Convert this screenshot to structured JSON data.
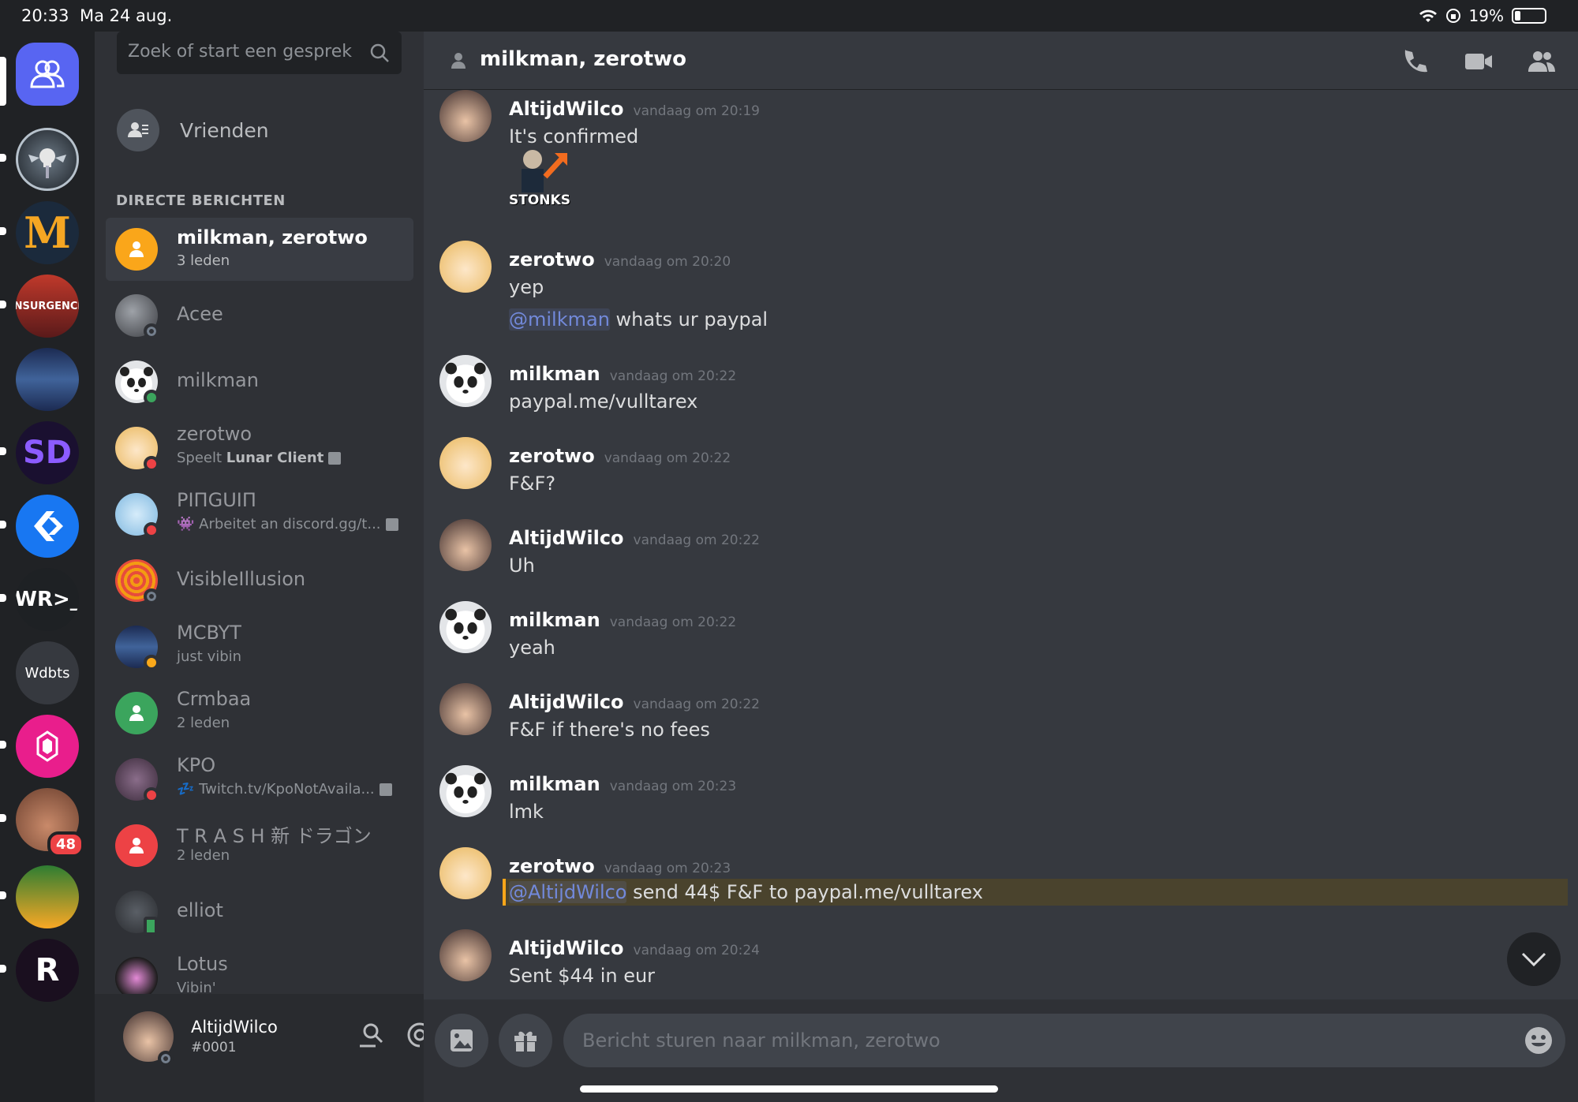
{
  "status_bar": {
    "time": "20:33",
    "date": "Ma 24 aug.",
    "battery": "19%",
    "battery_level": 0.19
  },
  "servers": [
    {
      "name": "home-button",
      "icon": "discord-friends-icon"
    },
    {
      "name": "server-skull-wings"
    },
    {
      "name": "server-m",
      "initial": "M"
    },
    {
      "name": "server-pokemon-insurgence",
      "label": "INSURGENCE"
    },
    {
      "name": "server-night-sky"
    },
    {
      "name": "server-sd",
      "initial": "SD"
    },
    {
      "name": "server-arrows"
    },
    {
      "name": "server-wr",
      "initial": "WR>_"
    },
    {
      "name": "server-wdbts",
      "initial": "Wdbts"
    },
    {
      "name": "server-pink-crystal"
    },
    {
      "name": "server-face",
      "badge": "48"
    },
    {
      "name": "server-roblox"
    },
    {
      "name": "server-r"
    }
  ],
  "search": {
    "placeholder": "Zoek of start een gesprek"
  },
  "friends_label": "Vrienden",
  "dm_section_title": "DIRECTE BERICHTEN",
  "dms": [
    {
      "name": "milkman, zerotwo",
      "sub": "3 leden",
      "active": true,
      "avatar_color": "#faa61a",
      "status": "group"
    },
    {
      "name": "Acee",
      "sub": "",
      "avatar_color": "#6b6e74",
      "status": "offline"
    },
    {
      "name": "milkman",
      "sub": "",
      "avatar_color": "#e3e5e8",
      "status": "online"
    },
    {
      "name": "zerotwo",
      "sub_prefix": "Speelt ",
      "sub_bold": "Lunar Client",
      "avatar_color": "#f4d38a",
      "status": "dnd"
    },
    {
      "name": "PIПGUIП",
      "sub": "Arbeitet an discord.gg/t...",
      "avatar_color": "#9fd1f0",
      "status": "dnd"
    },
    {
      "name": "VisibleIllusion",
      "sub": "",
      "avatar_color": "#d64a2c",
      "status": "offline"
    },
    {
      "name": "MCBYT",
      "sub": "just vibin",
      "avatar_color": "#33487a",
      "status": "idle"
    },
    {
      "name": "Crmbaa",
      "sub": "2 leden",
      "avatar_color": "#3ba55d",
      "status": "group"
    },
    {
      "name": "KPO",
      "sub": "Twitch.tv/KpoNotAvaila...",
      "avatar_color": "#5c4a5a",
      "status": "dnd"
    },
    {
      "name": "T R A S H 新 ドラゴン",
      "sub": "2 leden",
      "avatar_color": "#ed4245",
      "status": "group"
    },
    {
      "name": "elliot",
      "sub": "",
      "avatar_color": "#3a3c40",
      "status": "mobile"
    },
    {
      "name": "Lotus",
      "sub": "Vibin'",
      "avatar_color": "#1c1c1c",
      "status": "online"
    }
  ],
  "user": {
    "name": "AltijdWilco",
    "tag": "#0001"
  },
  "channel": {
    "title": "milkman, zerotwo"
  },
  "messages": [
    {
      "author": "AltijdWilco",
      "time": "vandaag om 20:19",
      "lines": [
        "It's confirmed"
      ],
      "sticker": "STONKS"
    },
    {
      "author": "zerotwo",
      "time": "vandaag om 20:20",
      "lines": [
        "yep"
      ],
      "mention_line": {
        "mention": "@milkman",
        "text": " whats ur paypal"
      }
    },
    {
      "author": "milkman",
      "time": "vandaag om 20:22",
      "lines": [
        "paypal.me/vulltarex"
      ]
    },
    {
      "author": "zerotwo",
      "time": "vandaag om 20:22",
      "lines": [
        "F&F?"
      ]
    },
    {
      "author": "AltijdWilco",
      "time": "vandaag om 20:22",
      "lines": [
        "Uh"
      ]
    },
    {
      "author": "milkman",
      "time": "vandaag om 20:22",
      "lines": [
        "yeah"
      ]
    },
    {
      "author": "AltijdWilco",
      "time": "vandaag om 20:22",
      "lines": [
        "F&F if there's no fees"
      ]
    },
    {
      "author": "milkman",
      "time": "vandaag om 20:23",
      "lines": [
        "lmk"
      ]
    },
    {
      "author": "zerotwo",
      "time": "vandaag om 20:23",
      "highlight_line": {
        "mention": "@AltijdWilco",
        "text": " send 44$ F&F to paypal.me/vulltarex"
      }
    },
    {
      "author": "AltijdWilco",
      "time": "vandaag om 20:24",
      "lines": [
        "Sent $44 in eur"
      ]
    }
  ],
  "composer": {
    "placeholder": "Bericht sturen naar milkman, zerotwo"
  },
  "colors": {
    "blurple": "#5865f2",
    "mention": "#7289da",
    "highlight_border": "#faa61a"
  }
}
